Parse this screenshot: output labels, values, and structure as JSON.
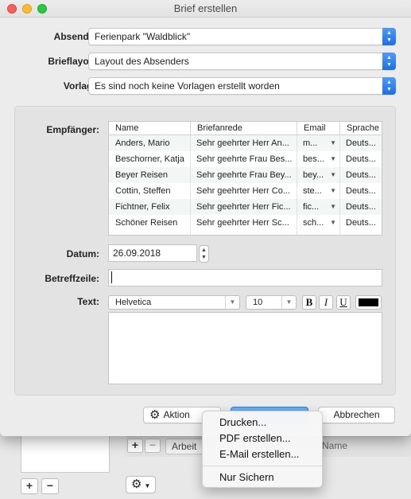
{
  "window": {
    "title": "Brief erstellen"
  },
  "form": {
    "absender_label": "Absender:",
    "absender_value": "Ferienpark \"Waldblick\"",
    "brieflayout_label": "Brieflayout:",
    "brieflayout_value": "Layout des Absenders",
    "vorlage_label": "Vorlage:",
    "vorlage_value": "Es sind noch keine Vorlagen erstellt worden",
    "empfaenger_label": "Empfänger:",
    "datum_label": "Datum:",
    "datum_value": "26.09.2018",
    "betreff_label": "Betreffzeile:",
    "betreff_value": "",
    "text_label": "Text:",
    "font_value": "Helvetica",
    "size_value": "10",
    "bold_label": "B",
    "italic_label": "I",
    "underline_label": "U",
    "text_color": "#000000"
  },
  "table": {
    "columns": [
      "Name",
      "Briefanrede",
      "Email",
      "Sprache"
    ],
    "rows": [
      {
        "name": "Anders, Mario",
        "anrede": "Sehr geehrter Herr An...",
        "email": "m...",
        "sprache": "Deuts..."
      },
      {
        "name": "Beschorner, Katja",
        "anrede": "Sehr geehrte Frau Bes...",
        "email": "bes...",
        "sprache": "Deuts..."
      },
      {
        "name": "Beyer Reisen",
        "anrede": "Sehr geehrte Frau Bey...",
        "email": "bey...",
        "sprache": "Deuts..."
      },
      {
        "name": "Cottin, Steffen",
        "anrede": "Sehr geehrter Herr Co...",
        "email": "ste...",
        "sprache": "Deuts..."
      },
      {
        "name": "Fichtner, Felix",
        "anrede": "Sehr geehrter Herr Fic...",
        "email": "fic...",
        "sprache": "Deuts..."
      },
      {
        "name": "Schöner Reisen",
        "anrede": "Sehr geehrter Herr Sc...",
        "email": "sch...",
        "sprache": "Deuts..."
      }
    ]
  },
  "buttons": {
    "aktion": "Aktion",
    "abbrechen": "Abbrechen"
  },
  "menu": {
    "items": [
      "Drucken...",
      "PDF erstellen...",
      "E-Mail erstellen...",
      "Nur Sichern"
    ]
  },
  "background": {
    "tab_label": "Arbeit",
    "column_label": "Name",
    "add": "+",
    "remove": "−"
  },
  "colors": {
    "accent": "#2f87f5",
    "close": "#fc5f57",
    "minimize": "#fdbc2e",
    "maximize": "#29c840"
  }
}
